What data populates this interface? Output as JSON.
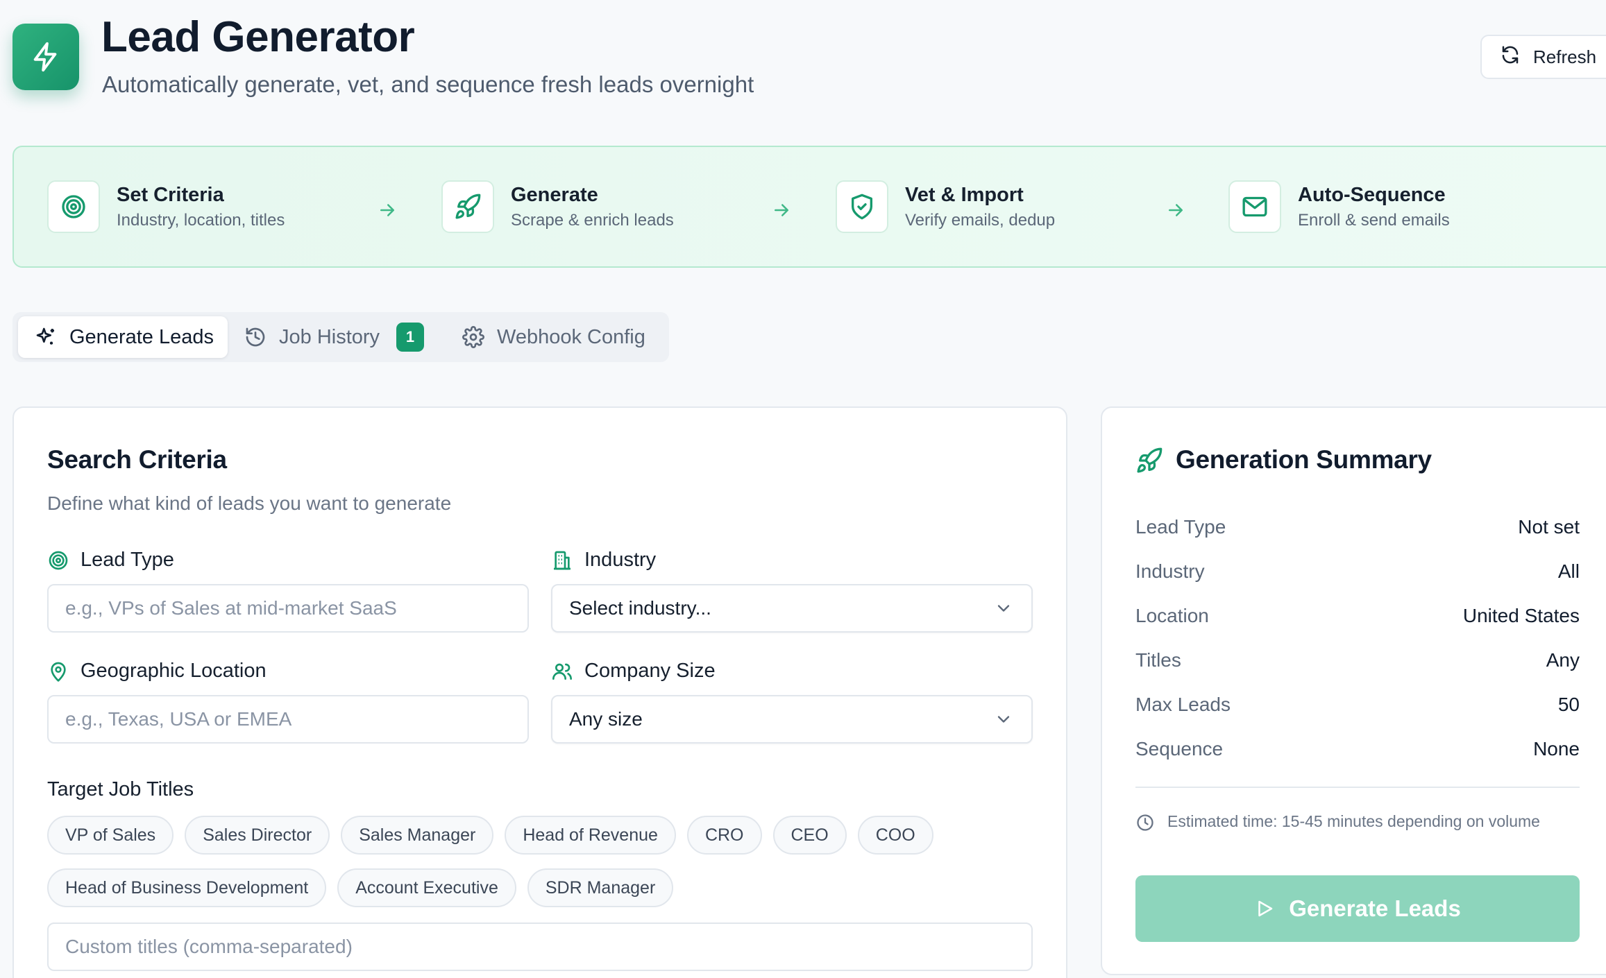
{
  "header": {
    "title": "Lead Generator",
    "subtitle": "Automatically generate, vet, and sequence fresh leads overnight",
    "logo_icon": "lightning-bolt-icon",
    "refresh_label": "Refresh"
  },
  "workflow_steps": [
    {
      "title": "Set Criteria",
      "description": "Industry, location, titles",
      "icon": "target-icon"
    },
    {
      "title": "Generate",
      "description": "Scrape & enrich leads",
      "icon": "rocket-icon"
    },
    {
      "title": "Vet & Import",
      "description": "Verify emails, dedup",
      "icon": "shield-check-icon"
    },
    {
      "title": "Auto-Sequence",
      "description": "Enroll & send emails",
      "icon": "mail-icon"
    }
  ],
  "tabs": [
    {
      "label": "Generate Leads",
      "icon": "sparkles-icon",
      "active": true
    },
    {
      "label": "Job History",
      "icon": "history-icon",
      "badge": "1"
    },
    {
      "label": "Webhook Config",
      "icon": "gear-icon"
    }
  ],
  "search_criteria": {
    "title": "Search Criteria",
    "description": "Define what kind of leads you want to generate",
    "lead_type": {
      "label": "Lead Type",
      "value": "",
      "placeholder": "e.g., VPs of Sales at mid-market SaaS"
    },
    "industry": {
      "label": "Industry",
      "selected": "Select industry..."
    },
    "location": {
      "label": "Geographic Location",
      "value": "",
      "placeholder": "e.g., Texas, USA or EMEA"
    },
    "company_size": {
      "label": "Company Size",
      "selected": "Any size"
    },
    "job_titles": {
      "label": "Target Job Titles",
      "row1": [
        "VP of Sales",
        "Sales Director",
        "Sales Manager",
        "Head of Revenue",
        "CRO",
        "CEO",
        "COO"
      ],
      "row2": [
        "Head of Business Development",
        "Account Executive",
        "SDR Manager"
      ],
      "custom_placeholder": "Custom titles (comma-separated)"
    }
  },
  "summary": {
    "title": "Generation Summary",
    "rows": [
      {
        "key": "Lead Type",
        "value": "Not set"
      },
      {
        "key": "Industry",
        "value": "All"
      },
      {
        "key": "Location",
        "value": "United States"
      },
      {
        "key": "Titles",
        "value": "Any"
      },
      {
        "key": "Max Leads",
        "value": "50"
      },
      {
        "key": "Sequence",
        "value": "None"
      }
    ],
    "estimate": "Estimated time: 15-45 minutes depending on volume",
    "button_label": "Generate Leads"
  },
  "colors": {
    "accent": "#169a6d",
    "accent_light": "#8dd5bc",
    "banner_bg": "#e6f8ef",
    "banner_border": "#b4e9cf"
  }
}
